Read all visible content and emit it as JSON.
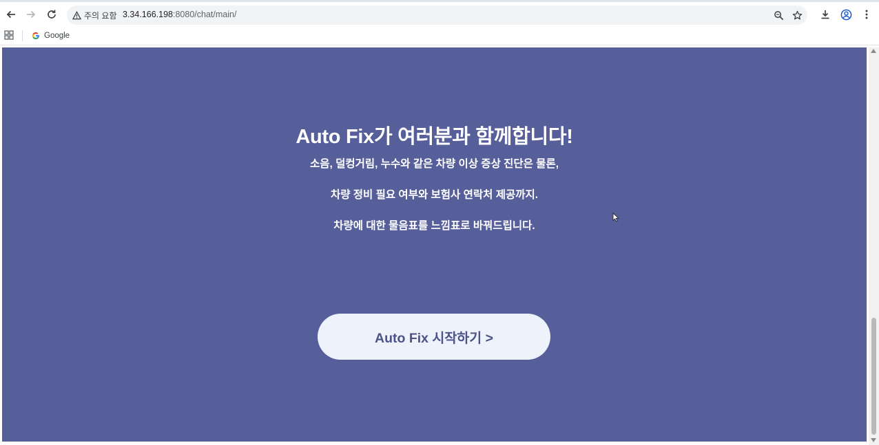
{
  "browser": {
    "security_label": "주의 요함",
    "url_host": "3.34.166.198",
    "url_rest": ":8080/chat/main/",
    "bookmarks": [
      {
        "label": "Google"
      }
    ],
    "icons": {
      "back": "arrow-left-icon",
      "forward": "arrow-right-icon",
      "reload": "reload-icon",
      "warning": "warning-icon",
      "zoom": "zoom-icon",
      "star": "star-icon",
      "download": "download-icon",
      "profile": "profile-icon",
      "menu": "kebab-menu-icon",
      "apps": "apps-grid-icon"
    }
  },
  "hero": {
    "title": "Auto Fix가 여러분과 함께합니다!",
    "lines": [
      "소음, 덜컹거림, 누수와 같은 차량 이상 증상 진단은 물론,",
      "차량 정비 필요 여부와 보험사 연락처 제공까지.",
      "차량에 대한 물음표를 느낌표로 바꿔드립니다."
    ],
    "cta_label": "Auto Fix 시작하기 >"
  },
  "colors": {
    "background": "#575f9b",
    "cta_background": "#eef2fb",
    "cta_text": "#4b5388"
  }
}
